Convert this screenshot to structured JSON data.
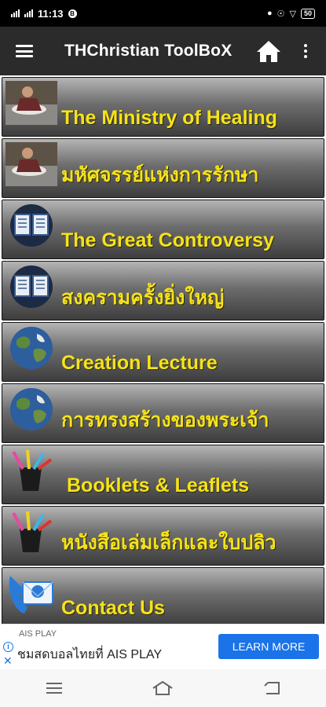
{
  "status_bar": {
    "time": "11:13",
    "battery": "50"
  },
  "app_bar": {
    "title": "THChristian ToolBoX",
    "menu_icon": "hamburger-menu-icon",
    "home_icon": "home-icon",
    "more_icon": "more-vert-icon"
  },
  "menu": {
    "items": [
      {
        "label": "The Ministry of Healing",
        "icon": "healing-photo"
      },
      {
        "label": "มหัศจรรย์แห่งการรักษา",
        "icon": "healing-photo"
      },
      {
        "label": "The Great Controversy",
        "icon": "book-icon"
      },
      {
        "label": "สงครามครั้งยิ่งใหญ่",
        "icon": "book-icon"
      },
      {
        "label": "Creation Lecture",
        "icon": "earth-icon"
      },
      {
        "label": "การทรงสร้างของพระเจ้า",
        "icon": "earth-icon"
      },
      {
        "label": "Booklets & Leaflets",
        "icon": "pencil-cup-icon"
      },
      {
        "label": "หนังสือเล่มเล็กและใบปลิว",
        "icon": "pencil-cup-icon"
      },
      {
        "label": "Contact Us",
        "icon": "mail-phone-icon"
      }
    ]
  },
  "ad": {
    "advertiser": "AIS PLAY",
    "headline": "ชมสดบอลไทยที่ AIS PLAY",
    "cta": "LEARN MORE"
  },
  "colors": {
    "label_yellow": "#f6e21b",
    "appbar_bg": "#2b2b2b",
    "ad_button": "#1a73e8"
  }
}
